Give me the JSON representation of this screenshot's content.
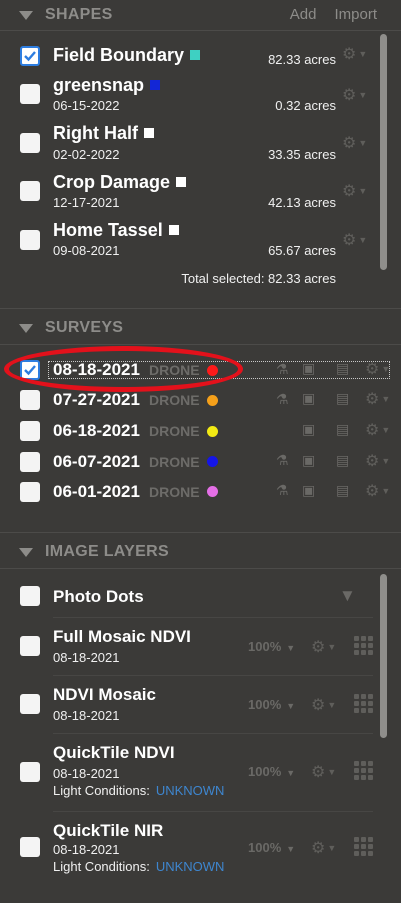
{
  "shapes": {
    "header": "SHAPES",
    "add": "Add",
    "import": "Import",
    "items": [
      {
        "name": "Field Boundary",
        "date": "",
        "acres": "82.33 acres",
        "color": "#3ed0c2",
        "checked": true
      },
      {
        "name": "greensnap",
        "date": "06-15-2022",
        "acres": "0.32 acres",
        "color": "#1326d6",
        "checked": false
      },
      {
        "name": "Right Half",
        "date": "02-02-2022",
        "acres": "33.35 acres",
        "color": "#ffffff",
        "checked": false
      },
      {
        "name": "Crop Damage",
        "date": "12-17-2021",
        "acres": "42.13 acres",
        "color": "#ffffff",
        "checked": false
      },
      {
        "name": "Home Tassel",
        "date": "09-08-2021",
        "acres": "65.67 acres",
        "color": "#ffffff",
        "checked": false
      }
    ],
    "total": "Total selected: 82.33 acres"
  },
  "surveys": {
    "header": "SURVEYS",
    "items": [
      {
        "date": "08-18-2021",
        "type": "DRONE",
        "color": "#ff1a1a",
        "checked": true
      },
      {
        "date": "07-27-2021",
        "type": "DRONE",
        "color": "#f5a01a",
        "checked": false
      },
      {
        "date": "06-18-2021",
        "type": "DRONE",
        "color": "#f2ea14",
        "checked": false
      },
      {
        "date": "06-07-2021",
        "type": "DRONE",
        "color": "#1515e8",
        "checked": false
      },
      {
        "date": "06-01-2021",
        "type": "DRONE",
        "color": "#e46fe6",
        "checked": false
      }
    ]
  },
  "image_layers": {
    "header": "IMAGE LAYERS",
    "photo_dots": "Photo Dots",
    "items": [
      {
        "name": "Full Mosaic NDVI",
        "date": "08-18-2021",
        "opacity": "100%"
      },
      {
        "name": "NDVI Mosaic",
        "date": "08-18-2021",
        "opacity": "100%"
      },
      {
        "name": "QuickTile NDVI",
        "date": "08-18-2021",
        "opacity": "100%",
        "light_label": "Light Conditions:",
        "light_value": "UNKNOWN"
      },
      {
        "name": "QuickTile NIR",
        "date": "08-18-2021",
        "opacity": "100%",
        "light_label": "Light Conditions:",
        "light_value": "UNKNOWN"
      }
    ]
  },
  "icons": {
    "gear": "gear-icon",
    "flask": "flask-icon",
    "image": "image-icon",
    "report": "report-icon",
    "filter": "filter-icon",
    "grid": "grid-icon"
  }
}
